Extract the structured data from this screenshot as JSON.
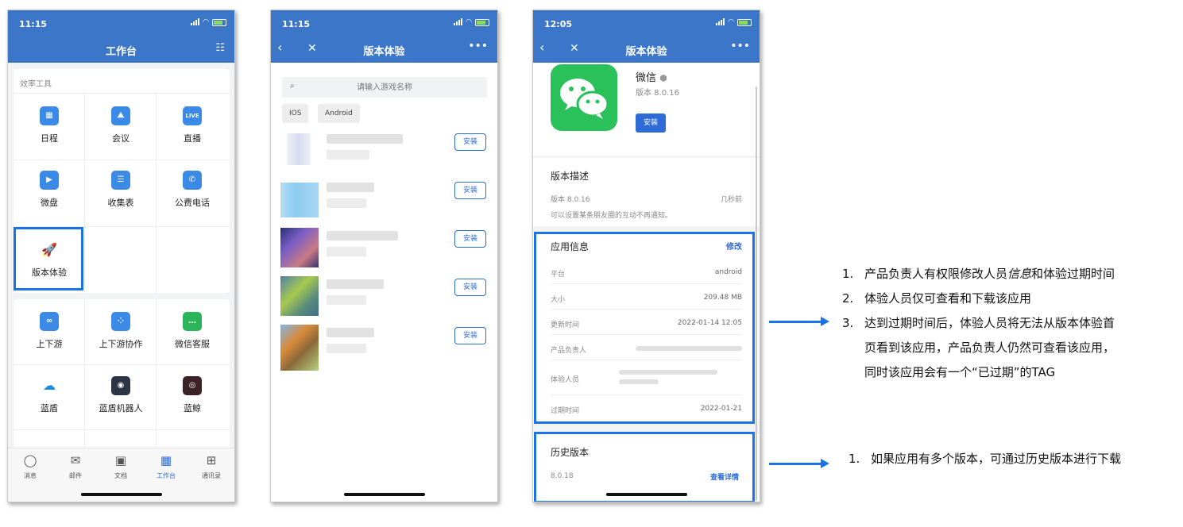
{
  "phone1": {
    "status_time": "11:15",
    "title": "工作台",
    "section_label": "效率工具",
    "apps_top": [
      {
        "label": "日程",
        "icon": "calendar-icon",
        "glyph": "▦"
      },
      {
        "label": "会议",
        "icon": "meeting-icon",
        "glyph": "⛰"
      },
      {
        "label": "直播",
        "icon": "live-icon",
        "glyph": "LIVE"
      },
      {
        "label": "微盘",
        "icon": "drive-icon",
        "glyph": "▶"
      },
      {
        "label": "收集表",
        "icon": "form-icon",
        "glyph": "☰"
      },
      {
        "label": "公费电话",
        "icon": "phone-icon",
        "glyph": "✆"
      },
      {
        "label": "版本体验",
        "icon": "rocket-icon",
        "glyph": "🚀"
      }
    ],
    "apps_bottom": [
      {
        "label": "上下游",
        "icon": "link-icon",
        "glyph": "∞"
      },
      {
        "label": "上下游协作",
        "icon": "grid-icon",
        "glyph": "⁘"
      },
      {
        "label": "微信客服",
        "icon": "chat-icon",
        "glyph": "…"
      },
      {
        "label": "蓝盾",
        "icon": "cloud-icon",
        "glyph": "☁"
      },
      {
        "label": "蓝盾机器人",
        "icon": "robot-icon",
        "glyph": "◉"
      },
      {
        "label": "蓝鲸",
        "icon": "whale-icon",
        "glyph": "◎"
      }
    ],
    "tabs": [
      {
        "label": "消息",
        "icon": "message-icon",
        "glyph": "◯"
      },
      {
        "label": "邮件",
        "icon": "mail-icon",
        "glyph": "✉"
      },
      {
        "label": "文档",
        "icon": "doc-icon",
        "glyph": "▣"
      },
      {
        "label": "工作台",
        "icon": "workbench-icon",
        "glyph": "▦"
      },
      {
        "label": "通讯录",
        "icon": "contacts-icon",
        "glyph": "⊞"
      }
    ],
    "colors": {
      "accent": "#3c76c9",
      "highlight": "#1a73e8"
    }
  },
  "phone2": {
    "status_time": "11:15",
    "title": "版本体验",
    "search_placeholder": "请输入游戏名称",
    "filters": [
      "IOS",
      "Android"
    ],
    "install_label": "安装"
  },
  "phone3": {
    "status_time": "12:05",
    "title": "版本体验",
    "app_name": "微信",
    "app_version": "版本 8.0.16",
    "install_label": "安装",
    "desc_title": "版本描述",
    "desc_version": "版本 8.0.16",
    "desc_time": "几秒前",
    "desc_text": "可以设置某条朋友圈的互动不再通知。",
    "info_title": "应用信息",
    "info_edit": "修改",
    "info_rows": [
      {
        "key": "平台",
        "value": "android"
      },
      {
        "key": "大小",
        "value": "209.48 MB"
      },
      {
        "key": "更新时间",
        "value": "2022-01-14 12:05"
      },
      {
        "key": "产品负责人",
        "value": ""
      },
      {
        "key": "体验人员",
        "value": ""
      },
      {
        "key": "过期时间",
        "value": "2022-01-21"
      }
    ],
    "history_title": "历史版本",
    "history_version": "8.0.18",
    "history_link": "查看详情"
  },
  "notes1": {
    "item1_num": "1.",
    "item1_a": "产品负责人有权限修改人员",
    "item1_em": "信息",
    "item1_b": "和体验过期时间",
    "item2_num": "2.",
    "item2": "体验人员仅可查看和下载该应用",
    "item3_num": "3.",
    "item3_l1": "达到过期时间后，体验人员将无法从版本体验首",
    "item3_l2": "页看到该应用，产品负责人仍然可查看该应用，",
    "item3_l3": "同时该应用会有一个“已过期”的TAG"
  },
  "notes2": {
    "item1_num": "1.",
    "item1": "如果应用有多个版本，可通过历史版本进行下载"
  }
}
